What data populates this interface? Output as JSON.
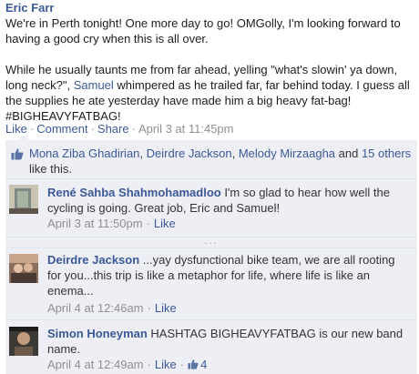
{
  "post": {
    "author": "Eric Farr",
    "paragraph1": "We're in Perth tonight! One more day to go! OMGolly, I'm looking forward to having a good cry when this is all over.",
    "paragraph2_before": "While he usually taunts me from far ahead, yelling \"what's slowin' ya down, long neck?\", ",
    "paragraph2_link": "Samuel",
    "paragraph2_after": " whimpered as he trailed far, far behind today. I guess all the supplies he ate yesterday have made him a big heavy fat-bag! #BIGHEAVYFATBAG!",
    "actions": {
      "like": "Like",
      "comment": "Comment",
      "share": "Share",
      "sep": "·",
      "timestamp": "April 3 at 11:45pm"
    }
  },
  "likes": {
    "name1": "Mona Ziba Ghadirian",
    "name2": "Deirdre Jackson",
    "name3": "Melody Mirzaagha",
    "and": " and ",
    "others": "15 others",
    "suffix": " like this.",
    "comma": ", "
  },
  "comments": [
    {
      "name": "René Sahba Shahmohamadloo",
      "text": " I'm so glad to hear how well the cycling is going. Great job, Eric and Samuel!",
      "time": "April 3 at 11:50pm",
      "like": "Like"
    },
    {
      "name": "Deirdre Jackson",
      "text": " ...yay dysfunctional bike team, we are all rooting for you...this trip is like a metaphor for life, where life is like an enema...",
      "time": "April 4 at 12:46am",
      "like": "Like"
    },
    {
      "name": "Simon Honeyman",
      "text": " HASHTAG BIGHEAVYFATBAG is our new band name.",
      "time": "April 4 at 12:49am",
      "like": "Like",
      "like_count": "4"
    }
  ],
  "more_indicator": "...",
  "colors": {
    "link": "#3b5998",
    "meta": "#8f8f8f",
    "feedback_bg": "#edeff4"
  }
}
